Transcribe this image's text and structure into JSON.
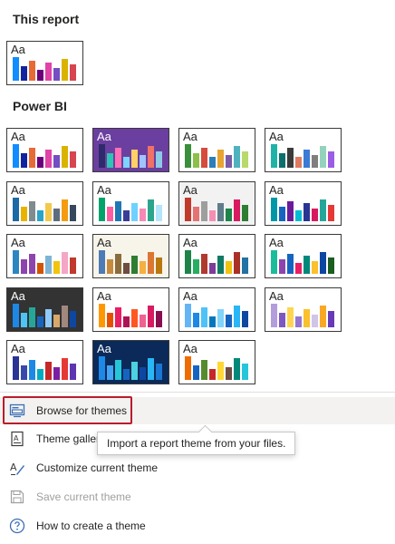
{
  "sections": {
    "this_report": "This report",
    "power_bi": "Power BI"
  },
  "tile_sample_text": "Aa",
  "themes": [
    {
      "group": "this_report",
      "bg": "#ffffff",
      "fg": "#252423",
      "colors": [
        "#118dff",
        "#12239e",
        "#e66c37",
        "#6b007b",
        "#e044a7",
        "#744ec2",
        "#d9b300",
        "#d64550"
      ]
    },
    {
      "group": "power_bi",
      "bg": "#ffffff",
      "fg": "#252423",
      "colors": [
        "#118dff",
        "#12239e",
        "#e66c37",
        "#6b007b",
        "#e044a7",
        "#744ec2",
        "#d9b300",
        "#d64550"
      ]
    },
    {
      "group": "power_bi",
      "bg": "#6b3fa0",
      "fg": "#ffffff",
      "colors": [
        "#2e2a6b",
        "#2ec4b6",
        "#ff6fb5",
        "#7cd4ff",
        "#ffd166",
        "#a0c4ff",
        "#f07167",
        "#8ecae6"
      ]
    },
    {
      "group": "power_bi",
      "bg": "#ffffff",
      "fg": "#252423",
      "colors": [
        "#3a8f3a",
        "#8cc04a",
        "#d64b3c",
        "#2c7fb8",
        "#e6a532",
        "#7a5aa6",
        "#4fb3bf",
        "#b8d96b"
      ]
    },
    {
      "group": "power_bi",
      "bg": "#ffffff",
      "fg": "#252423",
      "colors": [
        "#20b2a6",
        "#0d6e6e",
        "#3b3b3b",
        "#e07a5f",
        "#3a7bd5",
        "#7f7f7f",
        "#94d2bd",
        "#9b5de5"
      ]
    },
    {
      "group": "power_bi",
      "bg": "#ffffff",
      "fg": "#252423",
      "colors": [
        "#1b6aa5",
        "#e8b400",
        "#7f8c8d",
        "#2aa4c9",
        "#f2c94c",
        "#5d6d7e",
        "#f39c12",
        "#34495e"
      ]
    },
    {
      "group": "power_bi",
      "bg": "#ffffff",
      "fg": "#252423",
      "colors": [
        "#00a36c",
        "#ff5da2",
        "#1f77b4",
        "#3b3b98",
        "#6fd1ff",
        "#f58ab6",
        "#2ca58d",
        "#b3e5fc"
      ]
    },
    {
      "group": "power_bi",
      "bg": "#f2f2f2",
      "fg": "#252423",
      "colors": [
        "#c0392b",
        "#e57373",
        "#9e9e9e",
        "#f48fb1",
        "#607d8b",
        "#1e8449",
        "#d81b60",
        "#2e7d32"
      ]
    },
    {
      "group": "power_bi",
      "bg": "#ffffff",
      "fg": "#252423",
      "colors": [
        "#0097a7",
        "#1565c0",
        "#6a1b9a",
        "#00bcd4",
        "#283593",
        "#d81b60",
        "#26a69a",
        "#e53935"
      ]
    },
    {
      "group": "power_bi",
      "bg": "#ffffff",
      "fg": "#252423",
      "colors": [
        "#2e86c1",
        "#8e44ad",
        "#8e44ad",
        "#d35400",
        "#7fb3d5",
        "#f1c40f",
        "#f4a6c7",
        "#c0392b"
      ]
    },
    {
      "group": "power_bi",
      "bg": "#f7f4ea",
      "fg": "#252423",
      "colors": [
        "#4e7ab5",
        "#c58a3d",
        "#8a6d3b",
        "#6d4c41",
        "#2e7d32",
        "#f5b041",
        "#dc7633",
        "#b9770e"
      ]
    },
    {
      "group": "power_bi",
      "bg": "#ffffff",
      "fg": "#252423",
      "colors": [
        "#1e8449",
        "#27ae60",
        "#b03a2e",
        "#7d3c98",
        "#117a65",
        "#f1c40f",
        "#a93226",
        "#2471a3"
      ]
    },
    {
      "group": "power_bi",
      "bg": "#ffffff",
      "fg": "#252423",
      "colors": [
        "#1abc9c",
        "#8e44ad",
        "#1565c0",
        "#e91e63",
        "#00897b",
        "#fbc02d",
        "#0d47a1",
        "#1b5e20"
      ]
    },
    {
      "group": "power_bi",
      "bg": "#333333",
      "fg": "#ffffff",
      "colors": [
        "#1e88e5",
        "#4fc3f7",
        "#26a69a",
        "#1565c0",
        "#90caf9",
        "#d6a86b",
        "#a1887f",
        "#0d47a1"
      ]
    },
    {
      "group": "power_bi",
      "bg": "#ffffff",
      "fg": "#252423",
      "colors": [
        "#ff9800",
        "#e65100",
        "#e91e63",
        "#ad1457",
        "#ff5722",
        "#f06292",
        "#d81b60",
        "#880e4f"
      ]
    },
    {
      "group": "power_bi",
      "bg": "#ffffff",
      "fg": "#252423",
      "colors": [
        "#64b5f6",
        "#1e88e5",
        "#4fc3f7",
        "#0277bd",
        "#81d4fa",
        "#1565c0",
        "#29b6f6",
        "#0d47a1"
      ]
    },
    {
      "group": "power_bi",
      "bg": "#ffffff",
      "fg": "#252423",
      "colors": [
        "#b39ddb",
        "#7e57c2",
        "#ffd54f",
        "#9575cd",
        "#fbc02d",
        "#d1c4e9",
        "#f9a825",
        "#673ab7"
      ]
    },
    {
      "group": "power_bi",
      "bg": "#ffffff",
      "fg": "#252423",
      "colors": [
        "#283593",
        "#3949ab",
        "#1e88e5",
        "#00acc1",
        "#c62828",
        "#7b1fa2",
        "#e53935",
        "#5e35b1"
      ]
    },
    {
      "group": "power_bi",
      "bg": "#0b2a5a",
      "fg": "#ffffff",
      "colors": [
        "#1e88e5",
        "#42a5f5",
        "#26c6da",
        "#1565c0",
        "#4dd0e1",
        "#0d47a1",
        "#29b6f6",
        "#1976d2"
      ]
    },
    {
      "group": "power_bi",
      "bg": "#ffffff",
      "fg": "#252423",
      "colors": [
        "#ef6c00",
        "#1565c0",
        "#558b2f",
        "#c62828",
        "#fdd835",
        "#6d4c41",
        "#00897b",
        "#26c6da"
      ]
    }
  ],
  "menu": {
    "browse": "Browse for themes",
    "gallery": "Theme gallery",
    "customize": "Customize current theme",
    "save": "Save current theme",
    "howto": "How to create a theme"
  },
  "tooltip": "Import a report theme from your files."
}
